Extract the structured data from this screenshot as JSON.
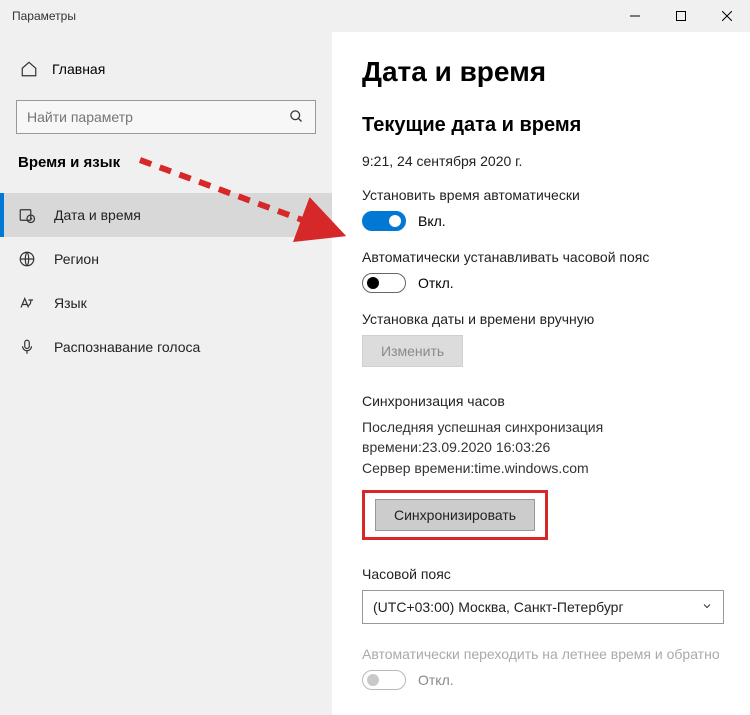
{
  "titlebar": {
    "title": "Параметры"
  },
  "sidebar": {
    "home_label": "Главная",
    "search_placeholder": "Найти параметр",
    "category": "Время и язык",
    "items": [
      {
        "label": "Дата и время"
      },
      {
        "label": "Регион"
      },
      {
        "label": "Язык"
      },
      {
        "label": "Распознавание голоса"
      }
    ]
  },
  "content": {
    "page_title": "Дата и время",
    "current_heading": "Текущие дата и время",
    "current_datetime": "9:21, 24 сентября 2020 г.",
    "auto_time": {
      "label": "Установить время автоматически",
      "state": "Вкл."
    },
    "auto_tz": {
      "label": "Автоматически устанавливать часовой пояс",
      "state": "Откл."
    },
    "manual": {
      "label": "Установка даты и времени вручную",
      "button": "Изменить"
    },
    "sync": {
      "heading": "Синхронизация часов",
      "last_line": "Последняя успешная синхронизация времени:23.09.2020 16:03:26",
      "server_line": "Сервер времени:time.windows.com",
      "button": "Синхронизировать"
    },
    "tz": {
      "heading": "Часовой пояс",
      "value": "(UTC+03:00) Москва, Санкт-Петербург"
    },
    "dst": {
      "label": "Автоматически переходить на летнее время и обратно",
      "state": "Откл."
    }
  }
}
